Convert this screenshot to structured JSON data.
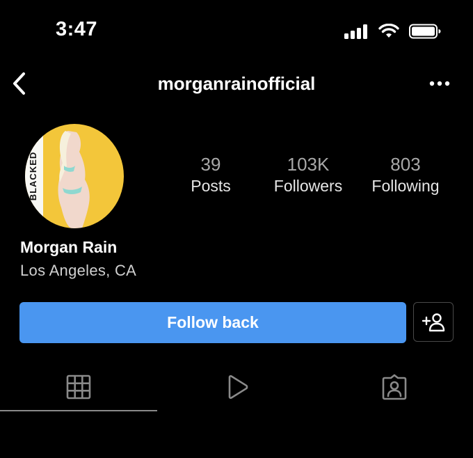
{
  "status_bar": {
    "time": "3:47",
    "icons": [
      "cellular-signal-icon",
      "wifi-icon",
      "battery-icon"
    ]
  },
  "nav": {
    "back_icon": "chevron-left-icon",
    "username": "morganrainofficial",
    "more_icon": "more-horizontal-icon"
  },
  "profile": {
    "avatar_watermark": "BLACKED",
    "display_name": "Morgan Rain",
    "location": "Los Angeles, CA",
    "stats": [
      {
        "value": "39",
        "label": "Posts"
      },
      {
        "value": "103K",
        "label": "Followers"
      },
      {
        "value": "803",
        "label": "Following"
      }
    ]
  },
  "actions": {
    "follow_label": "Follow back",
    "add_person_icon": "add-person-icon"
  },
  "tabs": [
    {
      "name": "posts",
      "icon": "grid-icon",
      "active": true
    },
    {
      "name": "reels",
      "icon": "play-icon",
      "active": false
    },
    {
      "name": "tagged",
      "icon": "tagged-person-icon",
      "active": false
    }
  ],
  "colors": {
    "background": "#000000",
    "button_blue": "#4a96f0",
    "avatar_yellow": "#f3c63a",
    "muted_text": "#a8a8a8"
  }
}
